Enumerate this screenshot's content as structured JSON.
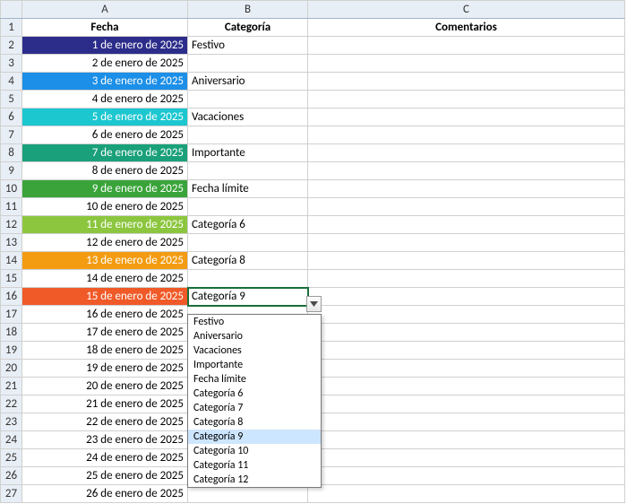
{
  "columns": {
    "a": "A",
    "b": "B",
    "c": "C"
  },
  "headers": {
    "fecha": "Fecha",
    "categoria": "Categoría",
    "comentarios": "Comentarios"
  },
  "rows": [
    {
      "n": "1"
    },
    {
      "n": "2",
      "date": "1 de enero de 2025",
      "cat": "Festivo",
      "hl": "bg-1"
    },
    {
      "n": "3",
      "date": "2 de enero de 2025"
    },
    {
      "n": "4",
      "date": "3 de enero de 2025",
      "cat": "Aniversario",
      "hl": "bg-3"
    },
    {
      "n": "5",
      "date": "4 de enero de 2025"
    },
    {
      "n": "6",
      "date": "5 de enero de 2025",
      "cat": "Vacaciones",
      "hl": "bg-5"
    },
    {
      "n": "7",
      "date": "6 de enero de 2025"
    },
    {
      "n": "8",
      "date": "7 de enero de 2025",
      "cat": "Importante",
      "hl": "bg-7"
    },
    {
      "n": "9",
      "date": "8 de enero de 2025"
    },
    {
      "n": "10",
      "date": "9 de enero de 2025",
      "cat": "Fecha límite",
      "hl": "bg-9"
    },
    {
      "n": "11",
      "date": "10 de enero de 2025"
    },
    {
      "n": "12",
      "date": "11 de enero de 2025",
      "cat": "Categoría 6",
      "hl": "bg-11"
    },
    {
      "n": "13",
      "date": "12 de enero de 2025"
    },
    {
      "n": "14",
      "date": "13 de enero de 2025",
      "cat": "Categoría 8",
      "hl": "bg-13"
    },
    {
      "n": "15",
      "date": "14 de enero de 2025"
    },
    {
      "n": "16",
      "date": "15 de enero de 2025",
      "cat": "Categoría 9",
      "hl": "bg-15",
      "selected": true
    },
    {
      "n": "17",
      "date": "16 de enero de 2025"
    },
    {
      "n": "18",
      "date": "17 de enero de 2025"
    },
    {
      "n": "19",
      "date": "18 de enero de 2025"
    },
    {
      "n": "20",
      "date": "19 de enero de 2025"
    },
    {
      "n": "21",
      "date": "20 de enero de 2025"
    },
    {
      "n": "22",
      "date": "21 de enero de 2025"
    },
    {
      "n": "23",
      "date": "22 de enero de 2025"
    },
    {
      "n": "24",
      "date": "23 de enero de 2025"
    },
    {
      "n": "25",
      "date": "24 de enero de 2025"
    },
    {
      "n": "26",
      "date": "25 de enero de 2025"
    },
    {
      "n": "27",
      "date": "26 de enero de 2025"
    }
  ],
  "dropdown": {
    "items": [
      "Festivo",
      "Aniversario",
      "Vacaciones",
      "Importante",
      "Fecha límite",
      "Categoría 6",
      "Categoría 7",
      "Categoría 8",
      "Categoría 9",
      "Categoría 10",
      "Categoría 11",
      "Categoría 12"
    ],
    "selected_index": 8
  }
}
